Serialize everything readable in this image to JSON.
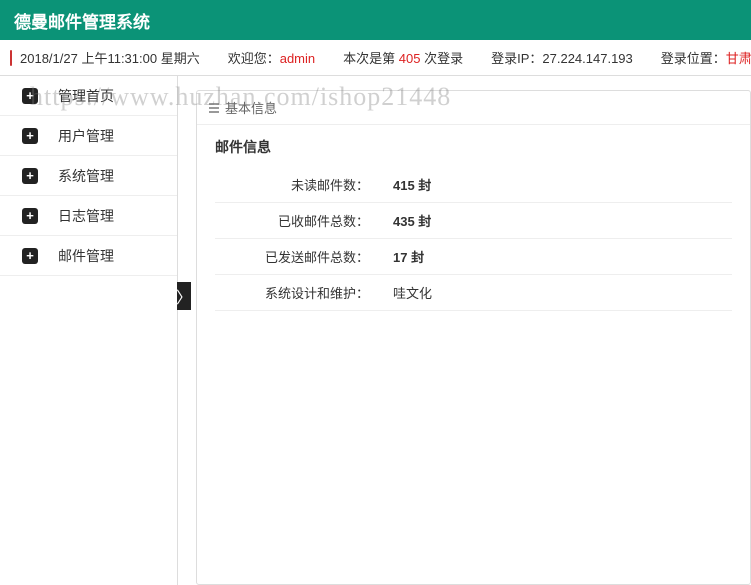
{
  "header": {
    "title": "德曼邮件管理系统"
  },
  "infobar": {
    "datetime": "2018/1/27 上午11:31:00 星期六",
    "welcome_prefix": "欢迎您：",
    "welcome_user": "admin",
    "login_count_prefix": "本次是第 ",
    "login_count": "405",
    "login_count_suffix": " 次登录",
    "ip_label": "登录IP：",
    "ip_value": "27.224.147.193",
    "location_label": "登录位置：",
    "location_value": "甘肃省"
  },
  "sidebar": {
    "items": [
      {
        "label": "管理首页"
      },
      {
        "label": "用户管理"
      },
      {
        "label": "系统管理"
      },
      {
        "label": "日志管理"
      },
      {
        "label": "邮件管理"
      }
    ],
    "collapse_glyph": "〉"
  },
  "panel": {
    "header": "基本信息",
    "section_title": "邮件信息",
    "rows": [
      {
        "label": "未读邮件数：",
        "value": "415 封"
      },
      {
        "label": "已收邮件总数：",
        "value": "435 封"
      },
      {
        "label": "已发送邮件总数：",
        "value": "17 封"
      },
      {
        "label": "系统设计和维护：",
        "value": "哇文化"
      }
    ]
  },
  "watermark": "https://www.huzhan.com/ishop21448"
}
